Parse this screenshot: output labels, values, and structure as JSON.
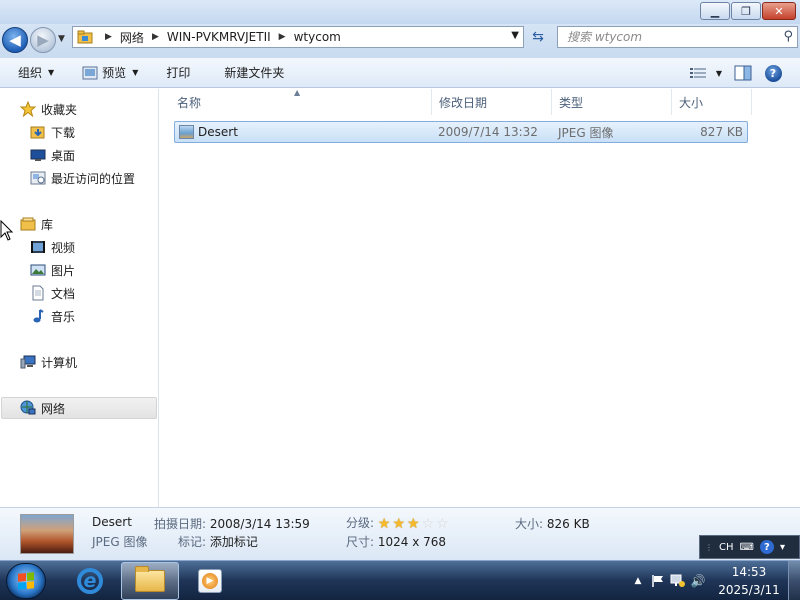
{
  "window": {
    "minimize_glyph": "▁",
    "maximize_glyph": "❐",
    "close_glyph": "✕"
  },
  "nav": {
    "back_glyph": "◀",
    "forward_glyph": "▶",
    "recent_glyph": "▼",
    "breadcrumb": [
      "网络",
      "WIN-PVKMRVJETII",
      "wtycom"
    ],
    "breadcrumb_sep": "▶",
    "address_dropdown_glyph": "▼",
    "refresh_glyph": "⇆",
    "search_placeholder": "搜索 wtycom",
    "search_glyph": "⚲"
  },
  "toolbar": {
    "organize": "组织",
    "preview": "预览",
    "print": "打印",
    "new_folder": "新建文件夹",
    "dropdown_glyph": "▼",
    "help_glyph": "?"
  },
  "sidebar": {
    "favorites": "收藏夹",
    "downloads": "下载",
    "desktop": "桌面",
    "recent_places": "最近访问的位置",
    "libraries": "库",
    "videos": "视频",
    "pictures": "图片",
    "documents": "文档",
    "music": "音乐",
    "computer": "计算机",
    "network": "网络"
  },
  "columns": {
    "name": "名称",
    "modified": "修改日期",
    "type": "类型",
    "size": "大小",
    "sort_glyph": "▲"
  },
  "files": [
    {
      "name": "Desert",
      "modified": "2009/7/14 13:32",
      "type": "JPEG 图像",
      "size": "827 KB"
    }
  ],
  "details": {
    "name": "Desert",
    "type": "JPEG 图像",
    "date_taken_label": "拍摄日期:",
    "date_taken": "2008/3/14 13:59",
    "tags_label": "标记:",
    "tags": "添加标记",
    "rating_label": "分级:",
    "rating": 3,
    "rating_max": 5,
    "dimensions_label": "尺寸:",
    "dimensions": "1024 x 768",
    "size_label": "大小:",
    "size": "826 KB"
  },
  "langbar": {
    "lang": "CH",
    "keyboard_glyph": "⌨",
    "help_glyph": "?",
    "minimize_glyph": "▾"
  },
  "taskbar": {
    "tray_expand_glyph": "▲",
    "volume_glyph": "🔊",
    "time": "14:53",
    "date": "2025/3/11"
  },
  "colors": {
    "selection": "#cce4f8",
    "accent": "#1f5fb6",
    "star_on": "#f5b92b",
    "star_off": "#d7d7d7"
  }
}
